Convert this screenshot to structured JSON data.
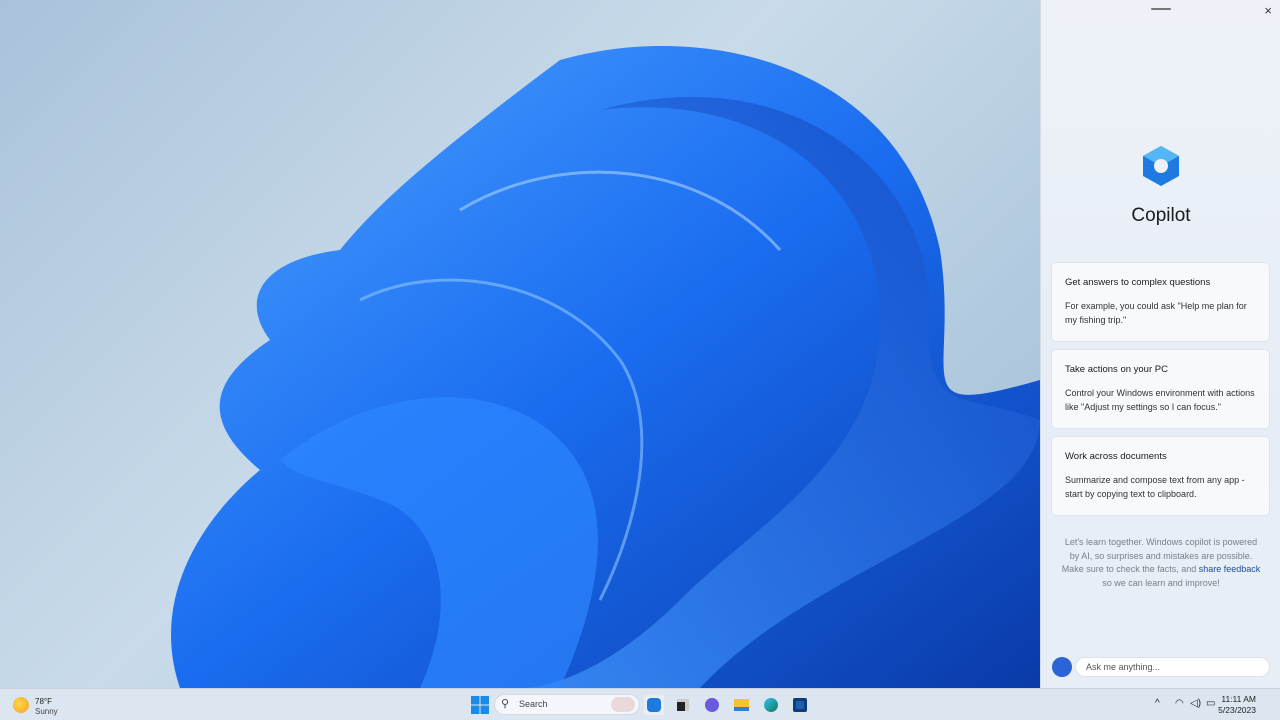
{
  "copilot": {
    "title": "Copilot",
    "close_icon": "×",
    "cards": [
      {
        "title": "Get answers to complex questions",
        "body": "For example, you could ask \"Help me plan for my fishing trip.\""
      },
      {
        "title": "Take actions on your PC",
        "body": "Control your Windows environment with actions like \"Adjust my settings so I can focus.\""
      },
      {
        "title": "Work across documents",
        "body": "Summarize and compose text from any app - start by copying text to clipboard."
      }
    ],
    "disclaimer_pre": "Let's learn together. Windows copilot is powered by AI, so surprises and mistakes are possible. Make sure to check the facts, and ",
    "disclaimer_link": "share feedback",
    "disclaimer_post": " so we can learn and improve!",
    "input_placeholder": "Ask me anything..."
  },
  "taskbar": {
    "weather_temp": "78°F",
    "weather_cond": "Sunny",
    "search_label": "Search",
    "search_icon": "⚲",
    "time": "11:11 AM",
    "date": "5/23/2023",
    "tray_chevron": "^",
    "colors": {
      "accent": "#2b63d8"
    }
  }
}
